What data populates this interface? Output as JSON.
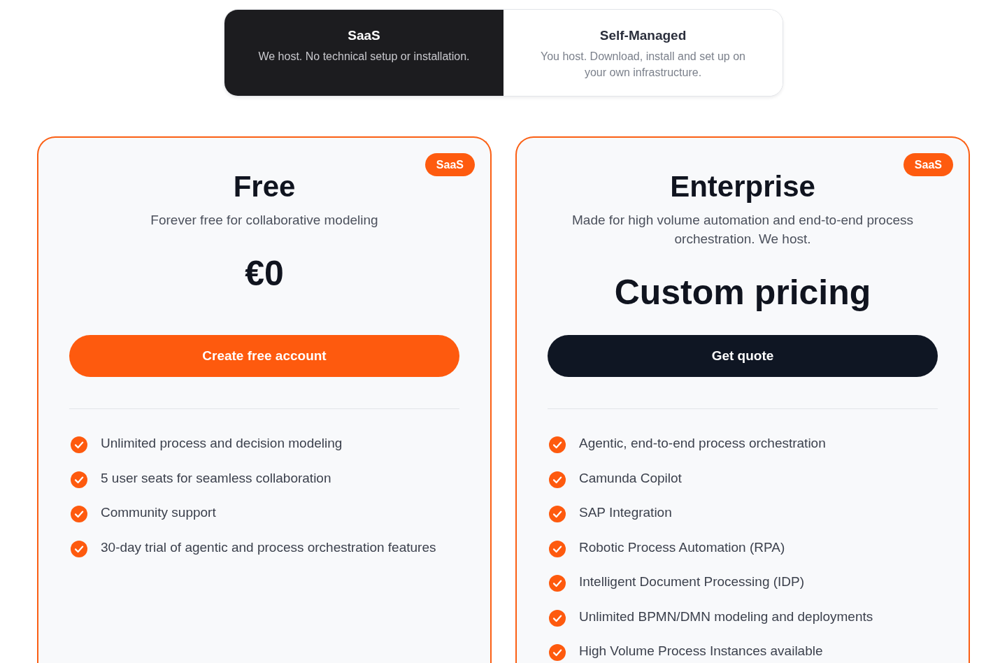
{
  "deployment_toggle": {
    "tabs": [
      {
        "title": "SaaS",
        "description": "We host. No technical setup or installation.",
        "selected": true
      },
      {
        "title": "Self-Managed",
        "description": "You host. Download, install and set up on your own infrastructure.",
        "selected": false
      }
    ]
  },
  "plans": [
    {
      "badge": "SaaS",
      "name": "Free",
      "tagline": "Forever free for collaborative modeling",
      "price": "€0",
      "button": {
        "label": "Create free account",
        "kind": "primary"
      },
      "features": [
        "Unlimited process and decision modeling",
        "5 user seats for seamless collaboration",
        "Community support",
        "30-day trial of agentic and process orchestration features"
      ]
    },
    {
      "badge": "SaaS",
      "name": "Enterprise",
      "tagline": "Made for high volume automation and end-to-end process orchestration. We host.",
      "price": "Custom pricing",
      "button": {
        "label": "Get quote",
        "kind": "dark"
      },
      "features": [
        "Agentic, end-to-end process orchestration",
        "Camunda Copilot",
        "SAP Integration",
        "Robotic Process Automation (RPA)",
        "Intelligent Document Processing (IDP)",
        "Unlimited BPMN/DMN modeling and deployments",
        "High Volume Process Instances available"
      ]
    }
  ]
}
